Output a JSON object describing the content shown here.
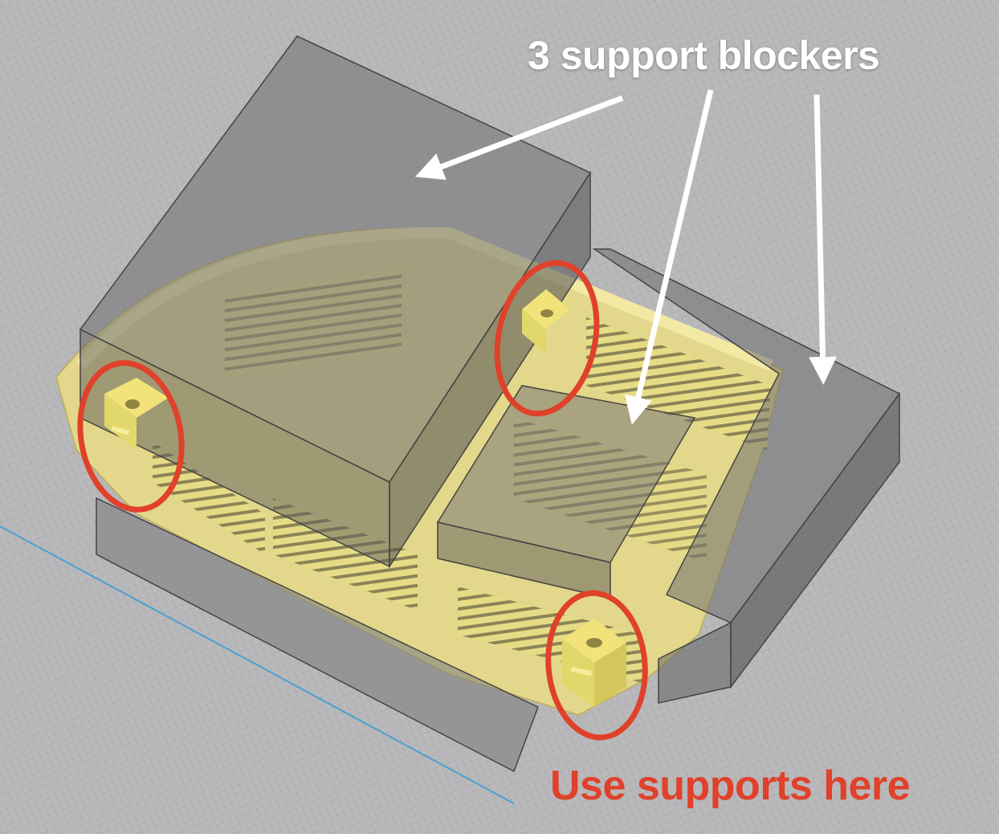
{
  "annotations": {
    "blockers_label": "3 support blockers",
    "supports_label": "Use supports here",
    "label_color": "#ffffff",
    "highlight_color": "#e0412a"
  },
  "scene": {
    "background_color": "#b7b7b9",
    "model_color": "#e9df8c",
    "blocker_color": "#6e6e70",
    "build_plate_edge_color": "#4a9fd4"
  },
  "support_callouts": [
    {
      "name": "left-support-tab"
    },
    {
      "name": "top-support-tab"
    },
    {
      "name": "front-support-tab"
    }
  ],
  "blocker_arrows": [
    {
      "name": "arrow-to-left-blocker"
    },
    {
      "name": "arrow-to-center-blocker"
    },
    {
      "name": "arrow-to-right-blocker"
    }
  ]
}
